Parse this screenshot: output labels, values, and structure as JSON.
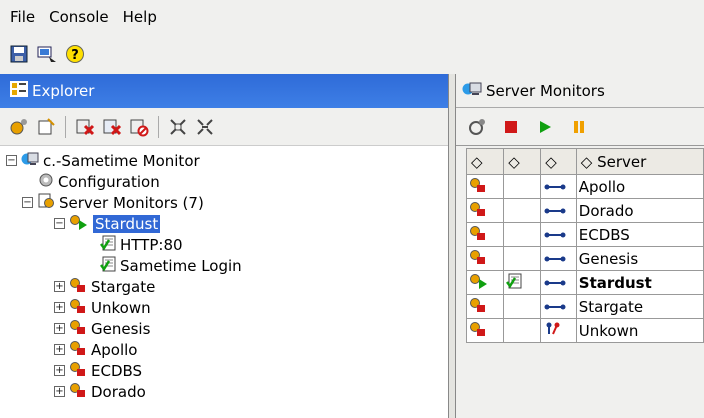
{
  "menu": {
    "items": [
      "File",
      "Console",
      "Help"
    ]
  },
  "explorer": {
    "title": "Explorer"
  },
  "tree": {
    "root": "c.-Sametime Monitor",
    "configuration": "Configuration",
    "server_monitors": "Server Monitors (7)",
    "selected": "Stardust",
    "children_of_selected": [
      "HTTP:80",
      "Sametime Login"
    ],
    "servers": [
      "Stargate",
      "Unkown",
      "Genesis",
      "Apollo",
      "ECDBS",
      "Dorado"
    ]
  },
  "monitors": {
    "title": "Server Monitors",
    "column_server": "Server",
    "rows": [
      {
        "name": "Apollo",
        "status": "down",
        "bold": false
      },
      {
        "name": "Dorado",
        "status": "down",
        "bold": false
      },
      {
        "name": "ECDBS",
        "status": "down",
        "bold": false
      },
      {
        "name": "Genesis",
        "status": "down",
        "bold": false
      },
      {
        "name": "Stardust",
        "status": "running",
        "bold": true
      },
      {
        "name": "Stargate",
        "status": "down",
        "bold": false
      },
      {
        "name": "Unkown",
        "status": "down",
        "bold": false
      }
    ]
  },
  "colors": {
    "selection": "#3168d5",
    "title_bar": "#3e7fe6",
    "stop": "#d01818",
    "play": "#10a010",
    "pause": "#f0a000"
  }
}
